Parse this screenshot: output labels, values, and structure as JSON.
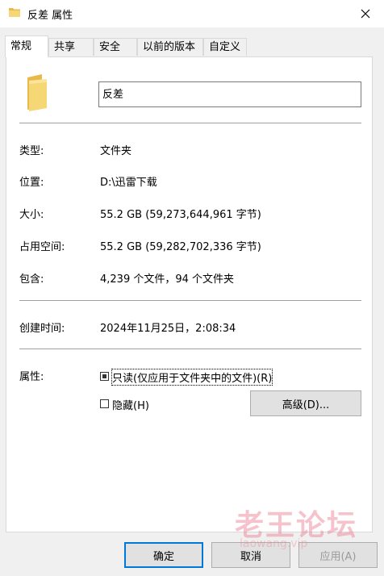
{
  "window": {
    "title": "反差 属性"
  },
  "tabs": [
    "常规",
    "共享",
    "安全",
    "以前的版本",
    "自定义"
  ],
  "general": {
    "folder_name": "反差",
    "rows": [
      {
        "label": "类型:",
        "value": "文件夹"
      },
      {
        "label": "位置:",
        "value": "D:\\迅雷下载"
      },
      {
        "label": "大小:",
        "value": "55.2 GB (59,273,644,961 字节)"
      },
      {
        "label": "占用空间:",
        "value": "55.2 GB (59,282,702,336 字节)"
      },
      {
        "label": "包含:",
        "value": "4,239 个文件，94 个文件夹"
      }
    ],
    "created": {
      "label": "创建时间:",
      "value": "2024年11月25日，2:08:34"
    },
    "attributes": {
      "label": "属性:",
      "readonly_label": "只读(仅应用于文件夹中的文件)(R)",
      "hidden_label": "隐藏(H)",
      "advanced_label": "高级(D)..."
    }
  },
  "buttons": {
    "ok": "确定",
    "cancel": "取消",
    "apply": "应用(A)"
  },
  "watermark": {
    "cn": "老王论坛",
    "en": "laowang.vip"
  },
  "colors": {
    "accent": "#0078d7",
    "folder": "#f6d776",
    "folder_dark": "#e9b949"
  }
}
